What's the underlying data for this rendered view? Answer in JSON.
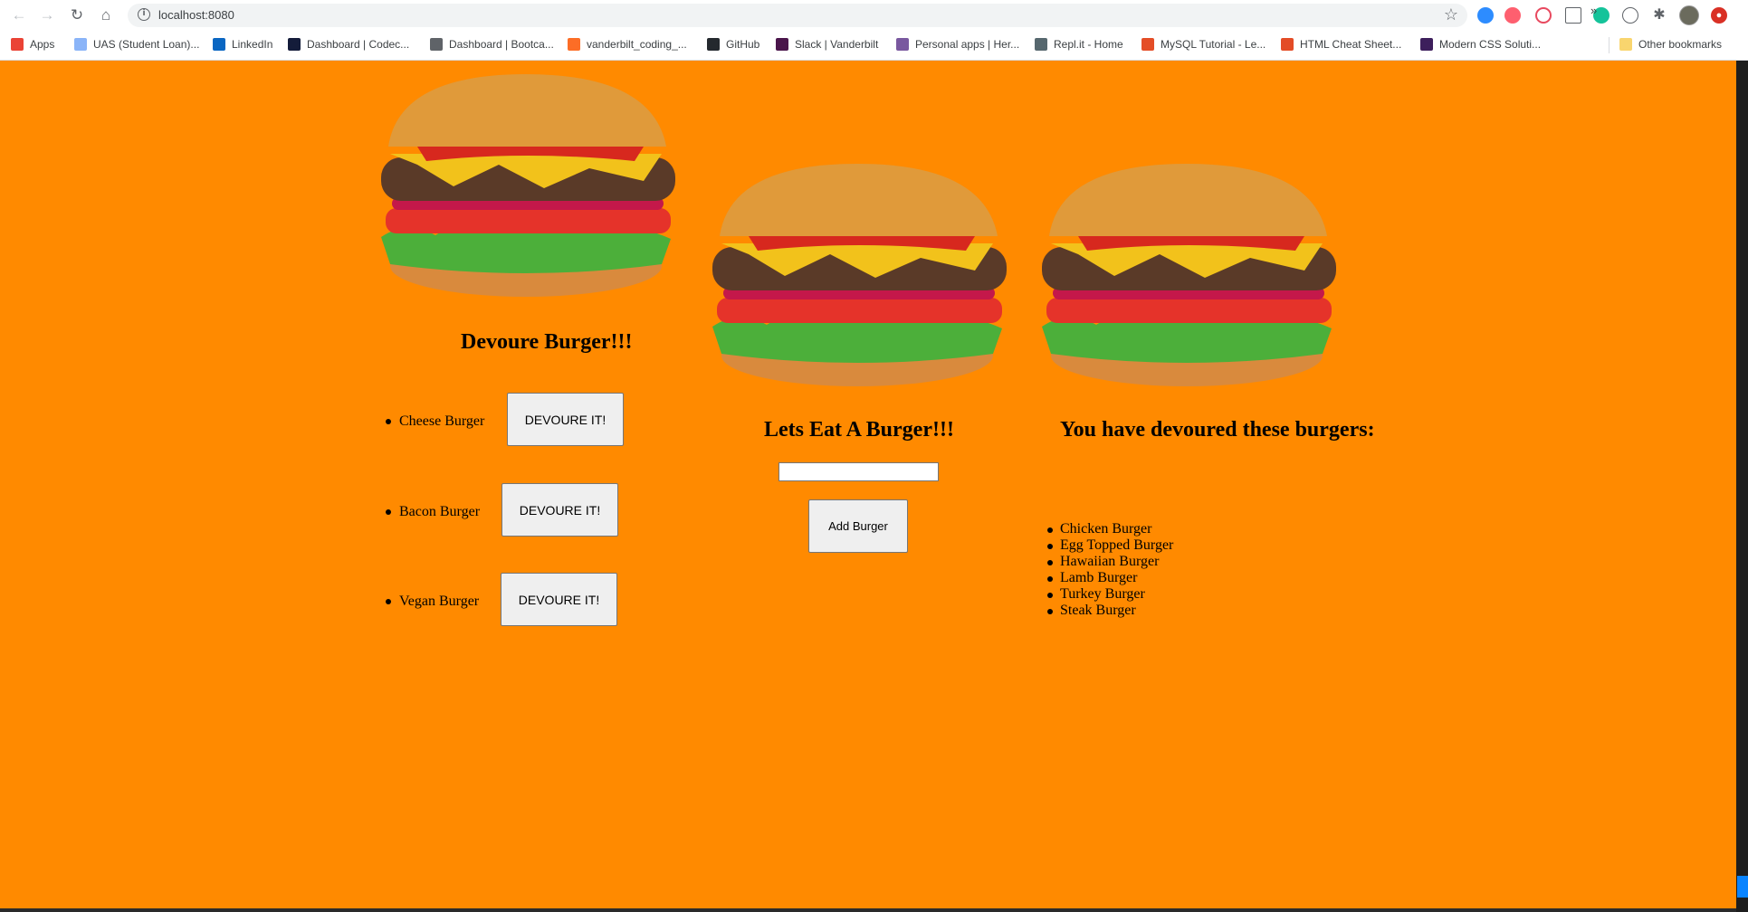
{
  "browser": {
    "url": "localhost:8080",
    "nav": {
      "back_icon": "arrow-left-icon",
      "forward_icon": "arrow-right-icon",
      "reload_icon": "reload-icon",
      "home_icon": "home-icon"
    },
    "bookmarks": [
      {
        "label": "Apps",
        "icon": "apps-grid-icon",
        "color": "#ea4335"
      },
      {
        "label": "UAS (Student Loan)...",
        "icon": "page-icon",
        "color": "#8ab4f8"
      },
      {
        "label": "LinkedIn",
        "icon": "linkedin-icon",
        "color": "#0a66c2"
      },
      {
        "label": "Dashboard | Codec...",
        "icon": "codecademy-icon",
        "color": "#141c3a"
      },
      {
        "label": "Dashboard | Bootca...",
        "icon": "bootcamp-icon",
        "color": "#5f6368"
      },
      {
        "label": "vanderbilt_coding_...",
        "icon": "gitlab-icon",
        "color": "#fc6d26"
      },
      {
        "label": "GitHub",
        "icon": "github-icon",
        "color": "#24292e"
      },
      {
        "label": "Slack | Vanderbilt",
        "icon": "slack-icon",
        "color": "#4a154b"
      },
      {
        "label": "Personal apps | Her...",
        "icon": "heroku-icon",
        "color": "#79589f"
      },
      {
        "label": "Repl.it - Home",
        "icon": "replit-icon",
        "color": "#56676e"
      },
      {
        "label": "MySQL Tutorial - Le...",
        "icon": "w3schools-icon",
        "color": "#e44d26"
      },
      {
        "label": "HTML Cheat Sheet...",
        "icon": "html-icon",
        "color": "#e34c26"
      },
      {
        "label": "Modern CSS Soluti...",
        "icon": "css-solutions-icon",
        "color": "#3d1f5c"
      }
    ],
    "more_bookmarks": "»",
    "other_bookmarks": {
      "label": "Other bookmarks",
      "icon": "folder-icon",
      "color": "#f9d56e"
    }
  },
  "page": {
    "background": "#ff8a00",
    "devour_column": {
      "heading": "Devoure Burger!!!",
      "items": [
        {
          "name": "Cheese Burger",
          "button": "DEVOURE IT!"
        },
        {
          "name": "Bacon Burger",
          "button": "DEVOURE IT!"
        },
        {
          "name": "Vegan Burger",
          "button": "DEVOURE IT!"
        }
      ]
    },
    "add_column": {
      "heading": "Lets Eat A Burger!!!",
      "input_value": "",
      "button": "Add Burger"
    },
    "devoured_column": {
      "heading": "You have devoured these burgers:",
      "items": [
        "Chicken Burger",
        "Egg Topped Burger",
        "Hawaiian Burger",
        "Lamb Burger",
        "Turkey Burger",
        "Steak Burger"
      ]
    }
  }
}
